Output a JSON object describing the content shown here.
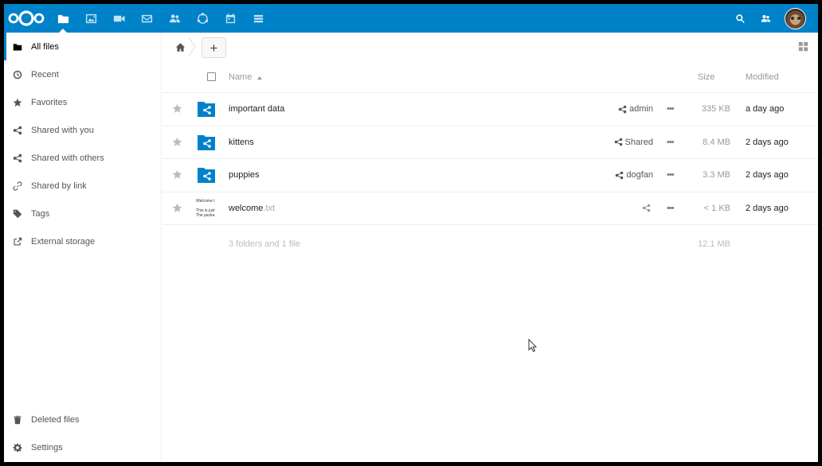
{
  "header": {
    "apps": [
      "files",
      "photos",
      "video-talk",
      "mail",
      "contacts",
      "circles",
      "calendar",
      "deck"
    ],
    "accent": "#0082c9"
  },
  "sidebar": {
    "items": [
      {
        "label": "All files",
        "icon": "folder-icon"
      },
      {
        "label": "Recent",
        "icon": "clock-icon"
      },
      {
        "label": "Favorites",
        "icon": "star-icon"
      },
      {
        "label": "Shared with you",
        "icon": "share-icon"
      },
      {
        "label": "Shared with others",
        "icon": "share-icon"
      },
      {
        "label": "Shared by link",
        "icon": "link-icon"
      },
      {
        "label": "Tags",
        "icon": "tag-icon"
      },
      {
        "label": "External storage",
        "icon": "external-icon"
      }
    ],
    "bottom": [
      {
        "label": "Deleted files",
        "icon": "trash-icon"
      },
      {
        "label": "Settings",
        "icon": "gear-icon"
      }
    ]
  },
  "controls": {
    "new_label": "+"
  },
  "table": {
    "headers": {
      "name": "Name",
      "size": "Size",
      "modified": "Modified"
    },
    "rows": [
      {
        "name": "important data",
        "ext": "",
        "share": "admin",
        "size": "335 KB",
        "modified": "a day ago",
        "type": "shared-folder"
      },
      {
        "name": "kittens",
        "ext": "",
        "share": "Shared",
        "size": "8.4 MB",
        "modified": "2 days ago",
        "type": "shared-folder"
      },
      {
        "name": "puppies",
        "ext": "",
        "share": "dogfan",
        "size": "3.3 MB",
        "modified": "2 days ago",
        "type": "shared-folder"
      },
      {
        "name": "welcome",
        "ext": ".txt",
        "share": "",
        "size": "< 1 KB",
        "modified": "2 days ago",
        "type": "text-file",
        "preview": [
          "Welcome t",
          "",
          "This is just",
          "The packa"
        ]
      }
    ],
    "more_label": "•••",
    "summary": {
      "text": "3 folders and 1 file",
      "size": "12.1 MB"
    }
  }
}
